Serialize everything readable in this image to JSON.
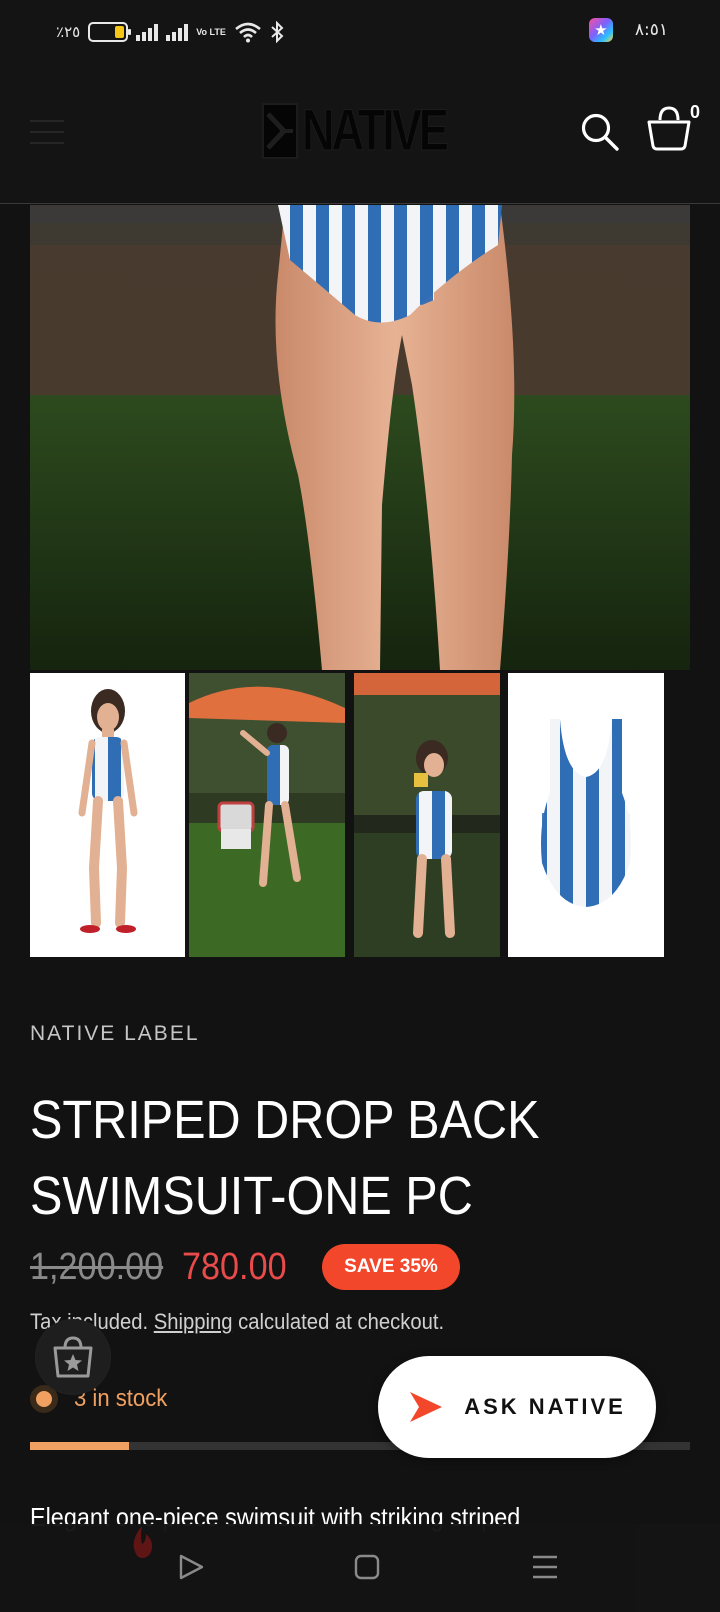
{
  "status_bar": {
    "battery_percent": "٪٢٥",
    "network": "Vo LTE",
    "time": "٨:٥١",
    "battery_color": "#f5c518"
  },
  "header": {
    "logo_text": "NATIVE",
    "cart_count": "0",
    "icons": [
      "menu-icon",
      "search-icon",
      "cart-icon"
    ]
  },
  "gallery": {
    "hero_alt": "Model wearing striped swimsuit on grass",
    "thumbnails": [
      "studio-front",
      "garden-umbrella",
      "garden-camera",
      "product-flat"
    ]
  },
  "product": {
    "vendor": "NATIVE LABEL",
    "title": "STRIPED DROP BACK SWIMSUIT-ONE PC",
    "compare_price": "1,200.00",
    "sale_price": "780.00",
    "save_badge": "SAVE 35%",
    "tax_prefix": "Tax included. ",
    "tax_link": "Shipping",
    "tax_suffix": " calculated at checkout.",
    "stock_text": "3 in stock",
    "stock_level": 0.15,
    "description": "Elegant one-piece swimsuit with striking striped",
    "sale_color": "#e94a4a",
    "badge_color": "#f2472b",
    "stock_color": "#f0a060"
  },
  "ask_button": {
    "label": "ASK NATIVE"
  }
}
